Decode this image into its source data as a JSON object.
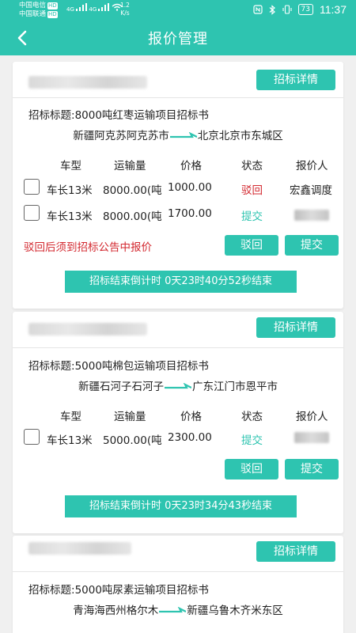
{
  "statusbar": {
    "carrier1": "中国电信",
    "carrier2": "中国联通",
    "hd": "HD",
    "net1": "4G",
    "net2": "4G",
    "speed_value": "1.2",
    "speed_unit": "K/s",
    "battery": "73",
    "time": "11:37"
  },
  "header": {
    "title": "报价管理",
    "back_icon": "back-arrow-icon"
  },
  "accent_color": "#2ec4b0",
  "reject_color": "#d3282f",
  "labels": {
    "detail": "招标详情",
    "reject": "驳回",
    "submit": "提交",
    "title_prefix": "招标标题:",
    "warn": "驳回后须到招标公告中报价",
    "col_vehicle": "车型",
    "col_volume": "运输量",
    "col_price": "价格",
    "col_status": "状态",
    "col_quoter": "报价人"
  },
  "cards": [
    {
      "title": "8000吨红枣运输项目招标书",
      "from": "新疆阿克苏阿克苏市",
      "to": "北京北京市东城区",
      "rows": [
        {
          "vehicle": "车长13米",
          "volume": "8000.00(吨",
          "price": "1000.00",
          "status": "驳回",
          "quoter": "宏鑫调度"
        },
        {
          "vehicle": "车长13米",
          "volume": "8000.00(吨",
          "price": "1700.00",
          "status": "提交",
          "quoter": ""
        }
      ],
      "countdown": "招标结束倒计时 0天23时40分52秒结束"
    },
    {
      "title": "5000吨棉包运输项目招标书",
      "from": "新疆石河子石河子",
      "to": "广东江门市恩平市",
      "rows": [
        {
          "vehicle": "车长13米",
          "volume": "5000.00(吨",
          "price": "2300.00",
          "status": "提交",
          "quoter": ""
        }
      ],
      "countdown": "招标结束倒计时 0天23时34分43秒结束"
    },
    {
      "title": "5000吨尿素运输项目招标书",
      "from": "青海海西州格尔木",
      "to": "新疆乌鲁木齐米东区"
    }
  ]
}
